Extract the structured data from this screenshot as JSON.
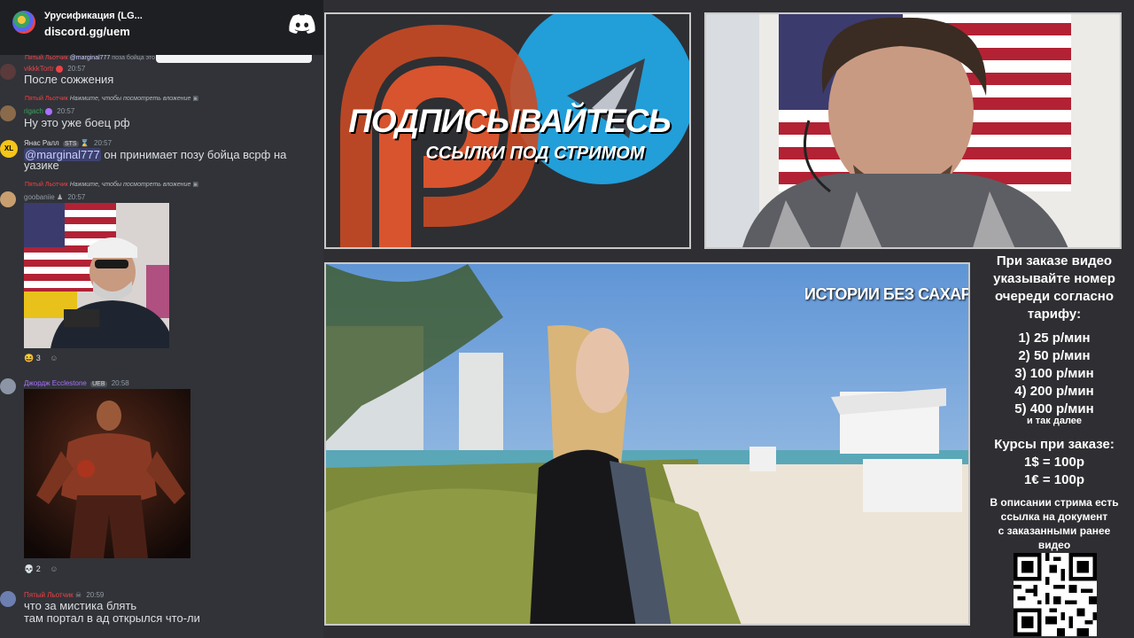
{
  "discord": {
    "server_name": "Урусификация (LG...",
    "server_link": "discord.gg/uem",
    "messages": [
      {
        "reply_author": "Пятый Льотчик",
        "reply_mention": "@marginal777",
        "reply_text": "поза бойца это",
        "author": "vikkkTortr",
        "author_color": "#ed4245",
        "time": "20:57",
        "text": "После сожжения"
      },
      {
        "reply_author": "Пятый Льотчик",
        "reply_text": "Нажмите, чтобы посмотреть вложение",
        "author": "rigach",
        "author_color": "#3ba55d",
        "time": "20:57",
        "text": "Ну это уже боец рф"
      },
      {
        "author": "Янас Ралл",
        "author_color": "#dbdee1",
        "badge": "STS",
        "time": "20:57",
        "mention": "@marginal777",
        "text_line1": " он принимает позу бойца всрф на",
        "text_line2": "уазике"
      },
      {
        "reply_author": "Пятый Льотчик",
        "reply_text": "Нажмите, чтобы посмотреть вложение",
        "author": "goobaniie",
        "author_color": "#949ba4",
        "time": "20:57",
        "reaction_count": "3"
      },
      {
        "author": "Джордж Ecclestone",
        "author_color": "#a970ff",
        "badge": "UEB",
        "time": "20:58",
        "reaction_count": "2"
      },
      {
        "author": "Пятый Льотчик",
        "author_color": "#ed4245",
        "time": "20:59",
        "text_line1": "что за мистика блять",
        "text_line2": "там портал в ад открылся что-ли"
      }
    ]
  },
  "banner": {
    "title": "ПОДПИСЫВАЙТЕСЬ",
    "subtitle": "ССЫЛКИ ПОД СТРИМОМ"
  },
  "video": {
    "watermark": "ИСТОРИИ БЕЗ САХАРА"
  },
  "info": {
    "head_lines": [
      "При заказе видео",
      "указывайте номер",
      "очереди согласно",
      "тарифу:"
    ],
    "tariffs": [
      "1) 25 р/мин",
      "2) 50 р/мин",
      "3) 100 р/мин",
      "4) 200 р/мин",
      "5) 400 р/мин"
    ],
    "and_more": "и так далее",
    "rates_title": "Курсы при заказе:",
    "rates": [
      "1$ = 100р",
      "1€ = 100р"
    ],
    "desc_lines": [
      "В описании стрима есть",
      "ссылка на документ",
      "с заказанными ранее",
      "видео"
    ]
  }
}
